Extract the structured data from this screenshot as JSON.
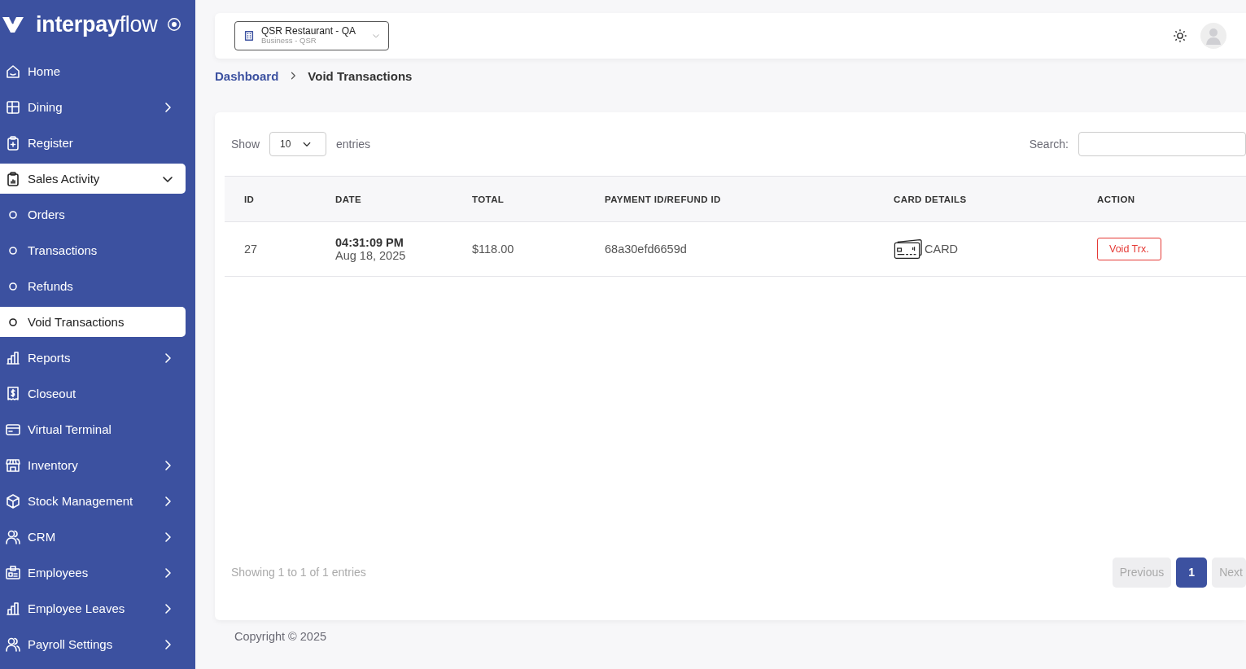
{
  "brand": {
    "name_bold": "interpay",
    "name_light": "flow"
  },
  "sidebar": {
    "items": [
      {
        "label": "Home",
        "expandable": false,
        "expanded": false
      },
      {
        "label": "Dining",
        "expandable": true,
        "expanded": false
      },
      {
        "label": "Register",
        "expandable": false,
        "expanded": false
      },
      {
        "label": "Sales Activity",
        "expandable": true,
        "expanded": true,
        "children": [
          {
            "label": "Orders",
            "selected": false
          },
          {
            "label": "Transactions",
            "selected": false
          },
          {
            "label": "Refunds",
            "selected": false
          },
          {
            "label": "Void Transactions",
            "selected": true
          }
        ]
      },
      {
        "label": "Reports",
        "expandable": true,
        "expanded": false
      },
      {
        "label": "Closeout",
        "expandable": false,
        "expanded": false
      },
      {
        "label": "Virtual Terminal",
        "expandable": false,
        "expanded": false
      },
      {
        "label": "Inventory",
        "expandable": true,
        "expanded": false
      },
      {
        "label": "Stock Management",
        "expandable": true,
        "expanded": false
      },
      {
        "label": "CRM",
        "expandable": true,
        "expanded": false
      },
      {
        "label": "Employees",
        "expandable": true,
        "expanded": false
      },
      {
        "label": "Employee Leaves",
        "expandable": true,
        "expanded": false
      },
      {
        "label": "Payroll Settings",
        "expandable": true,
        "expanded": false
      }
    ]
  },
  "topbar": {
    "business": {
      "name": "QSR Restaurant - QA",
      "subtitle": "Business - QSR"
    }
  },
  "breadcrumb": [
    {
      "label": "Dashboard",
      "current": false
    },
    {
      "label": "Void Transactions",
      "current": true
    }
  ],
  "table_controls": {
    "show_label": "Show",
    "page_size": "10",
    "entries_label": "entries",
    "search_label": "Search:"
  },
  "table": {
    "columns": [
      "ID",
      "DATE",
      "TOTAL",
      "PAYMENT ID/REFUND ID",
      "CARD DETAILS",
      "ACTION"
    ],
    "rows": [
      {
        "id": "27",
        "time": "04:31:09 PM",
        "date": "Aug 18, 2025",
        "total": "$118.00",
        "payment_id": "68a30efd6659d",
        "card": "CARD",
        "action": "Void Trx."
      }
    ]
  },
  "pagination": {
    "info": "Showing 1 to 1 of 1 entries",
    "previous": {
      "label": "Previous",
      "disabled": true
    },
    "pages": [
      {
        "label": "1",
        "selected": true
      }
    ],
    "next": {
      "label": "Next",
      "disabled": true
    }
  },
  "footer": {
    "copyright": "Copyright © 2025"
  }
}
